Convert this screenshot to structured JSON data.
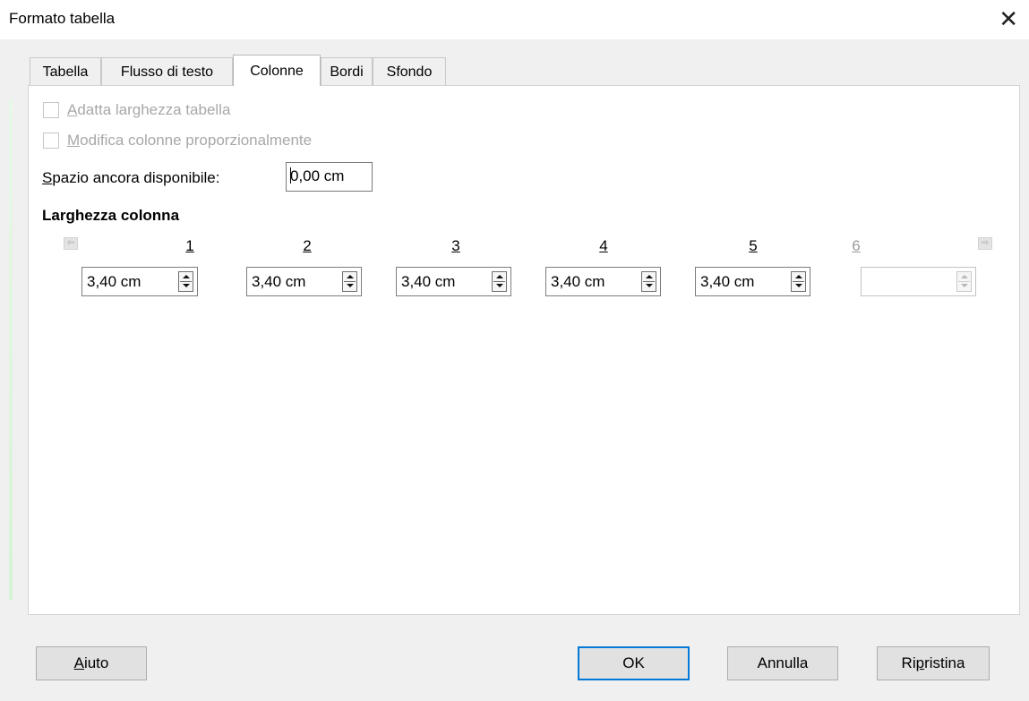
{
  "window": {
    "title": "Formato tabella",
    "close_icon": "close-icon"
  },
  "tabs": [
    {
      "label": "Tabella",
      "active": false
    },
    {
      "label": "Flusso di testo",
      "active": false
    },
    {
      "label": "Colonne",
      "active": true
    },
    {
      "label": "Bordi",
      "active": false
    },
    {
      "label": "Sfondo",
      "active": false
    }
  ],
  "options": {
    "fit_width": {
      "mnemonic": "A",
      "rest": "datta larghezza tabella",
      "checked": false,
      "enabled": false
    },
    "proportional": {
      "mnemonic": "M",
      "rest": "odifica colonne proporzionalmente",
      "checked": false,
      "enabled": false
    }
  },
  "remaining_space": {
    "mnemonic": "S",
    "rest": "pazio ancora disponibile:",
    "value": "0,00 cm"
  },
  "column_width": {
    "heading": "Larghezza colonna",
    "columns": [
      {
        "number": "1",
        "value": "3,40 cm",
        "enabled": true
      },
      {
        "number": "2",
        "value": "3,40 cm",
        "enabled": true
      },
      {
        "number": "3",
        "value": "3,40 cm",
        "enabled": true
      },
      {
        "number": "4",
        "value": "3,40 cm",
        "enabled": true
      },
      {
        "number": "5",
        "value": "3,40 cm",
        "enabled": true
      },
      {
        "number": "6",
        "value": "",
        "enabled": false
      }
    ]
  },
  "buttons": {
    "help": {
      "mnemonic": "A",
      "rest": "iuto"
    },
    "ok": "OK",
    "cancel": "Annulla",
    "reset": {
      "before": "Ri",
      "mnemonic": "p",
      "rest": "ristina"
    }
  }
}
